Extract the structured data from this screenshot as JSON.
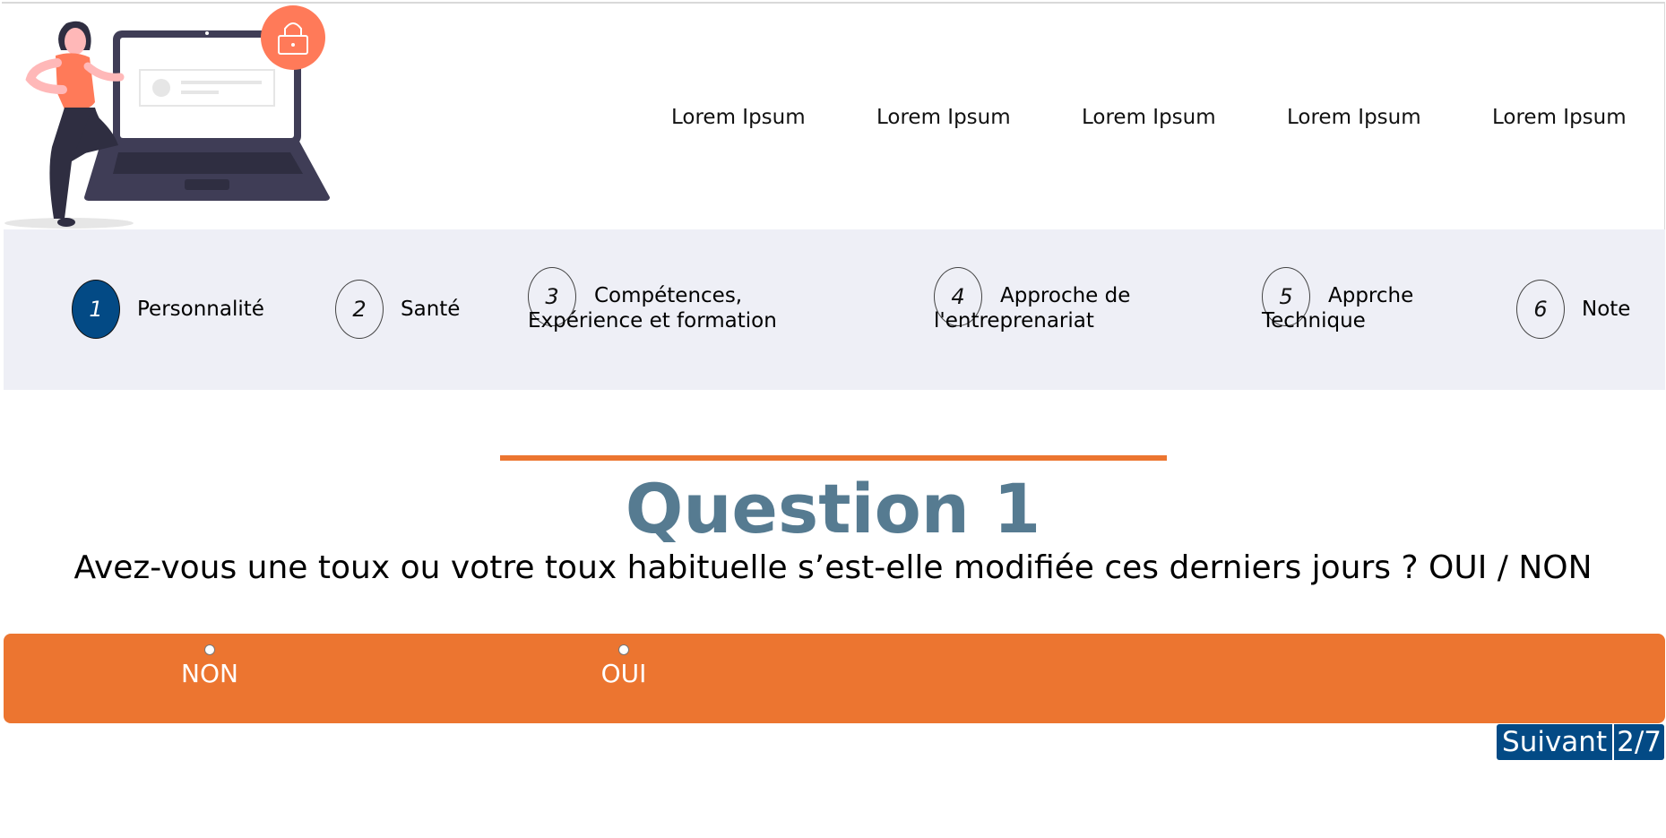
{
  "nav": {
    "links": [
      "Lorem Ipsum",
      "Lorem Ipsum",
      "Lorem Ipsum",
      "Lorem Ipsum",
      "Lorem Ipsum"
    ]
  },
  "steps": [
    {
      "number": "1",
      "label": "Personnalité",
      "active": true
    },
    {
      "number": "2",
      "label": "Santé",
      "active": false
    },
    {
      "number": "3",
      "label_line1": "Compétences,",
      "label_line2": "Expérience et formation",
      "active": false
    },
    {
      "number": "4",
      "label_line1": "Approche de",
      "label_line2": "l'entreprenariat",
      "active": false
    },
    {
      "number": "5",
      "label_line1": "Apprche",
      "label_line2": "Technique",
      "active": false
    },
    {
      "number": "6",
      "label": "Note",
      "active": false
    }
  ],
  "question": {
    "title": "Question 1",
    "text": "Avez-vous une toux ou votre toux habituelle s’est-elle modifiée ces derniers jours ? OUI / NON"
  },
  "answers": {
    "options": [
      "NON",
      "OUI"
    ]
  },
  "next": {
    "label": "Suivant",
    "progress": "2/7"
  },
  "colors": {
    "accent_orange": "#ec7530",
    "primary_blue": "#034a85",
    "title_blue_gray": "#567b91",
    "steps_bg": "#eeeff6"
  },
  "icons": [
    "lock-icon",
    "person-laptop-illustration"
  ]
}
